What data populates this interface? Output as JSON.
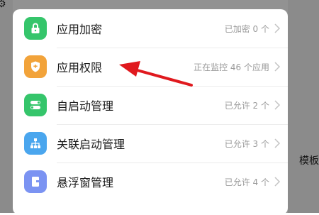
{
  "background": {
    "side_text": "模板"
  },
  "menu": {
    "items": [
      {
        "label": "应用加密",
        "status": "已加密 0 个",
        "icon": "lock-icon",
        "color": "#35c56b"
      },
      {
        "label": "应用权限",
        "status": "正在监控 46 个应用",
        "icon": "shield-icon",
        "color": "#f2a33a"
      },
      {
        "label": "自启动管理",
        "status": "已允许 2 个",
        "icon": "toggle-icon",
        "color": "#35c56b"
      },
      {
        "label": "关联启动管理",
        "status": "已允许 3 个",
        "icon": "network-icon",
        "color": "#4aa6ee"
      },
      {
        "label": "悬浮窗管理",
        "status": "已允许 4 个",
        "icon": "floating-window-icon",
        "color": "#7b93f2"
      }
    ]
  },
  "annotation": {
    "arrow_color": "#e0191e"
  }
}
